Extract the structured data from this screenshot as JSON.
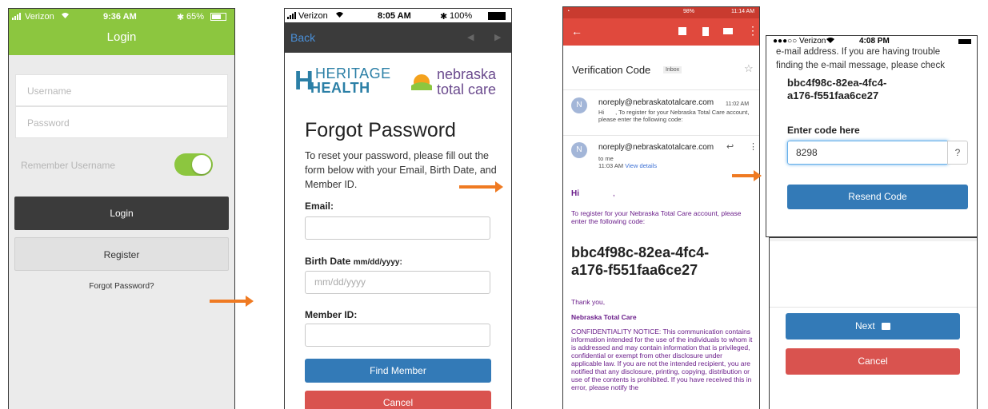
{
  "screen1": {
    "status": {
      "carrier": "Verizon",
      "time": "9:36 AM",
      "battery": "65%"
    },
    "title": "Login",
    "username_placeholder": "Username",
    "password_placeholder": "Password",
    "remember_label": "Remember Username",
    "remember_on": true,
    "login_label": "Login",
    "register_label": "Register",
    "forgot_link": "Forgot Password?"
  },
  "screen2": {
    "status": {
      "carrier": "Verizon",
      "time": "8:05 AM",
      "battery": "100%"
    },
    "back_label": "Back",
    "logo": {
      "word1": "HERITAGE",
      "word2": "HEALTH",
      "brand1": "nebraska",
      "brand2": "total care"
    },
    "heading": "Forgot Password",
    "instructions": "To reset your password, please fill out the form below with your Email, Birth Date, and Member ID.",
    "email_label": "Email:",
    "birth_label": "Birth Date",
    "birth_hint": "mm/dd/yyyy:",
    "birth_placeholder": "mm/dd/yyyy",
    "member_label": "Member ID:",
    "find_label": "Find Member",
    "cancel_label": "Cancel"
  },
  "screen3": {
    "status": {
      "indicators": "98%",
      "time": "11:14 AM"
    },
    "subject": "Verification Code",
    "inbox_badge": "Inbox",
    "msg1": {
      "avatar": "N",
      "sender": "noreply@nebraskatotalcare.com",
      "time": "11:02 AM",
      "preview_hi": "Hi",
      "preview": ", To register for your Nebraska Total Care account, please enter the following code:"
    },
    "msg2": {
      "avatar": "N",
      "sender": "noreply@nebraskatotalcare.com",
      "to": "to me",
      "time": "11:03 AM",
      "details": "View details"
    },
    "greeting": "Hi",
    "greeting_comma": ",",
    "body_line": "To register for your Nebraska Total Care account, please enter the following code:",
    "code_line1": "bbc4f98c-82ea-4fc4-",
    "code_line2": "a176-f551faa6ce27",
    "thanks": "Thank you,",
    "signature": "Nebraska Total Care",
    "notice": "CONFIDENTIALITY NOTICE: This communication contains information intended for the use of the individuals to whom it is addressed and may contain information that is privileged, confidential or exempt from other disclosure under applicable law. If you are not the intended recipient, you are notified that any disclosure, printing, copying, distribution or use of the contents is prohibited. If you have received this in error, please notify the"
  },
  "screen4": {
    "status": {
      "carrier": "Verizon",
      "time": "4:08 PM"
    },
    "text_line1": "e-mail address. If you are having trouble",
    "text_line2": "finding the e-mail message, please check",
    "code_line1": "bbc4f98c-82ea-4fc4-",
    "code_line2": "a176-f551faa6ce27",
    "enter_label": "Enter code here",
    "code_value": "8298",
    "help_label": "?",
    "resend_label": "Resend Code",
    "next_label": "Next",
    "cancel_label": "Cancel"
  },
  "colors": {
    "accent_green": "#8cc63f",
    "primary_blue": "#337ab7",
    "danger_red": "#d9534f",
    "gmail_red": "#e0493d",
    "arrow_orange": "#ef7a22"
  }
}
